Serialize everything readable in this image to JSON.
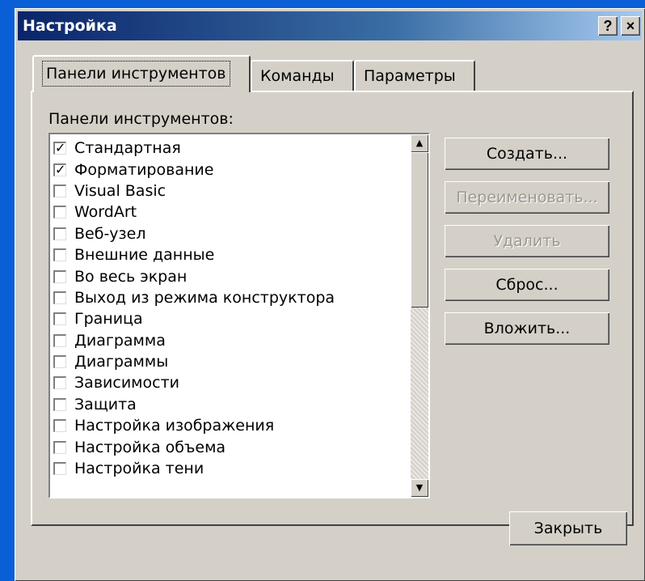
{
  "window": {
    "title": "Настройка",
    "help_glyph": "?",
    "close_glyph": "×"
  },
  "tabs": [
    {
      "label": "Панели инструментов",
      "active": true
    },
    {
      "label": "Команды",
      "active": false
    },
    {
      "label": "Параметры",
      "active": false
    }
  ],
  "toolbars_panel": {
    "label": "Панели инструментов:",
    "items": [
      {
        "label": "Стандартная",
        "checked": true
      },
      {
        "label": "Форматирование",
        "checked": true
      },
      {
        "label": "Visual Basic",
        "checked": false
      },
      {
        "label": "WordArt",
        "checked": false
      },
      {
        "label": "Веб-узел",
        "checked": false
      },
      {
        "label": "Внешние данные",
        "checked": false
      },
      {
        "label": "Во весь экран",
        "checked": false
      },
      {
        "label": "Выход из режима конструктора",
        "checked": false
      },
      {
        "label": "Граница",
        "checked": false
      },
      {
        "label": "Диаграмма",
        "checked": false
      },
      {
        "label": "Диаграммы",
        "checked": false
      },
      {
        "label": "Зависимости",
        "checked": false
      },
      {
        "label": "Защита",
        "checked": false
      },
      {
        "label": "Настройка изображения",
        "checked": false
      },
      {
        "label": "Настройка объема",
        "checked": false
      },
      {
        "label": "Настройка тени",
        "checked": false
      }
    ],
    "check_glyph": "✓",
    "scroll_up_glyph": "▲",
    "scroll_down_glyph": "▼"
  },
  "buttons": {
    "create": "Создать...",
    "rename": "Переименовать...",
    "delete": "Удалить",
    "reset": "Сброс...",
    "attach": "Вложить...",
    "close": "Закрыть"
  }
}
